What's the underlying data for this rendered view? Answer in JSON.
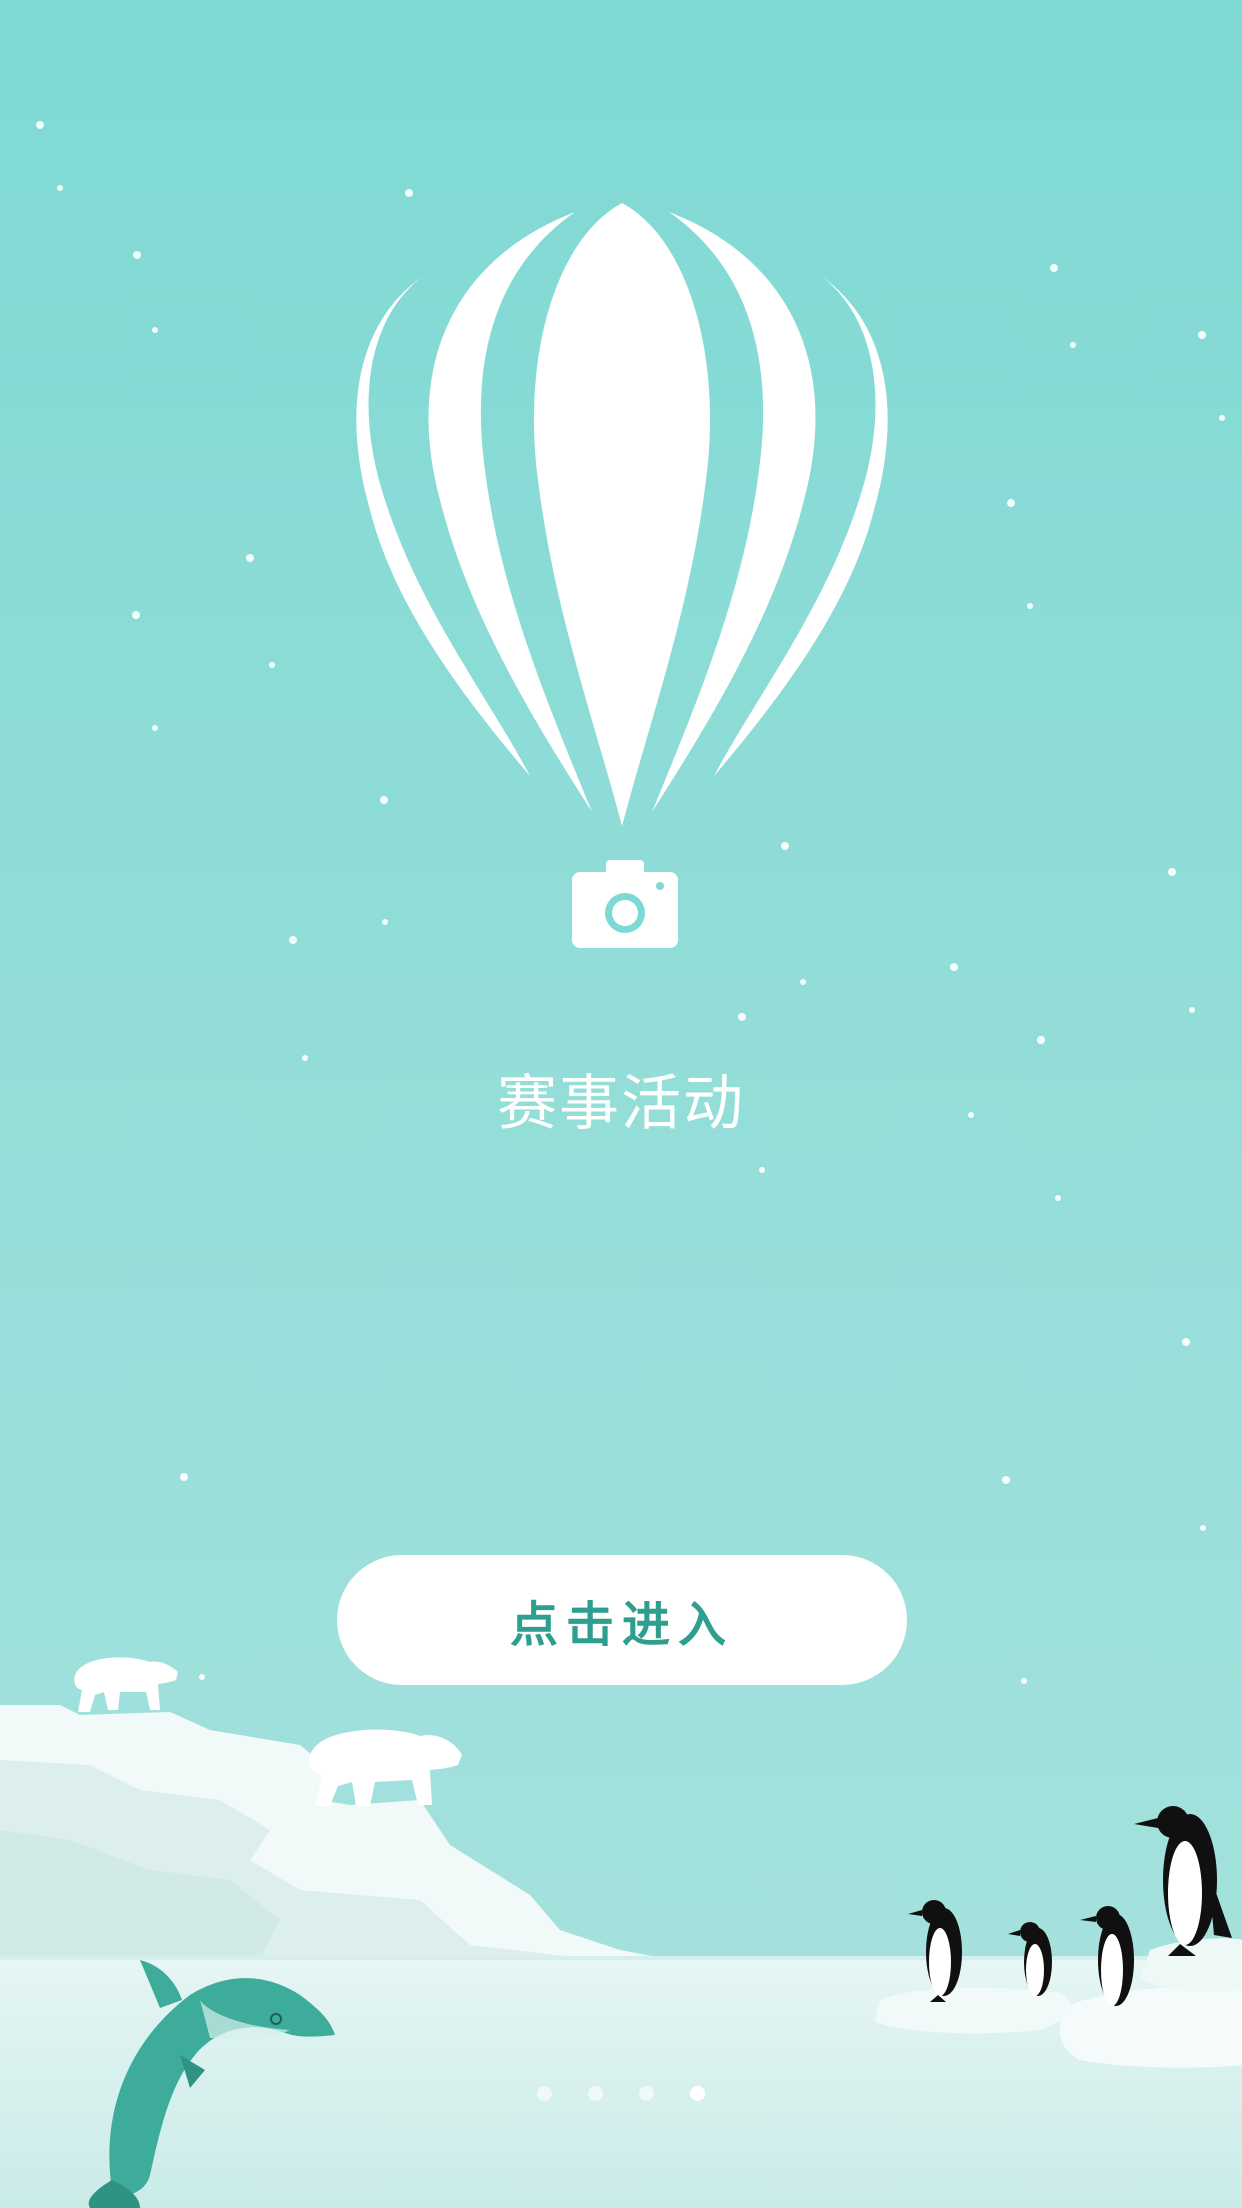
{
  "page": {
    "title": "赛事活动",
    "enter_button_label": "点击进入"
  },
  "pager": {
    "count": 4,
    "active_index": 3
  },
  "colors": {
    "background_top": "#7fd9d3",
    "background_bottom": "#a9e2de",
    "accent": "#2e9e8e",
    "white": "#ffffff"
  },
  "icons": [
    "hot-air-balloon-icon",
    "camera-icon",
    "polar-bear-icon",
    "dolphin-icon",
    "penguin-icon"
  ]
}
